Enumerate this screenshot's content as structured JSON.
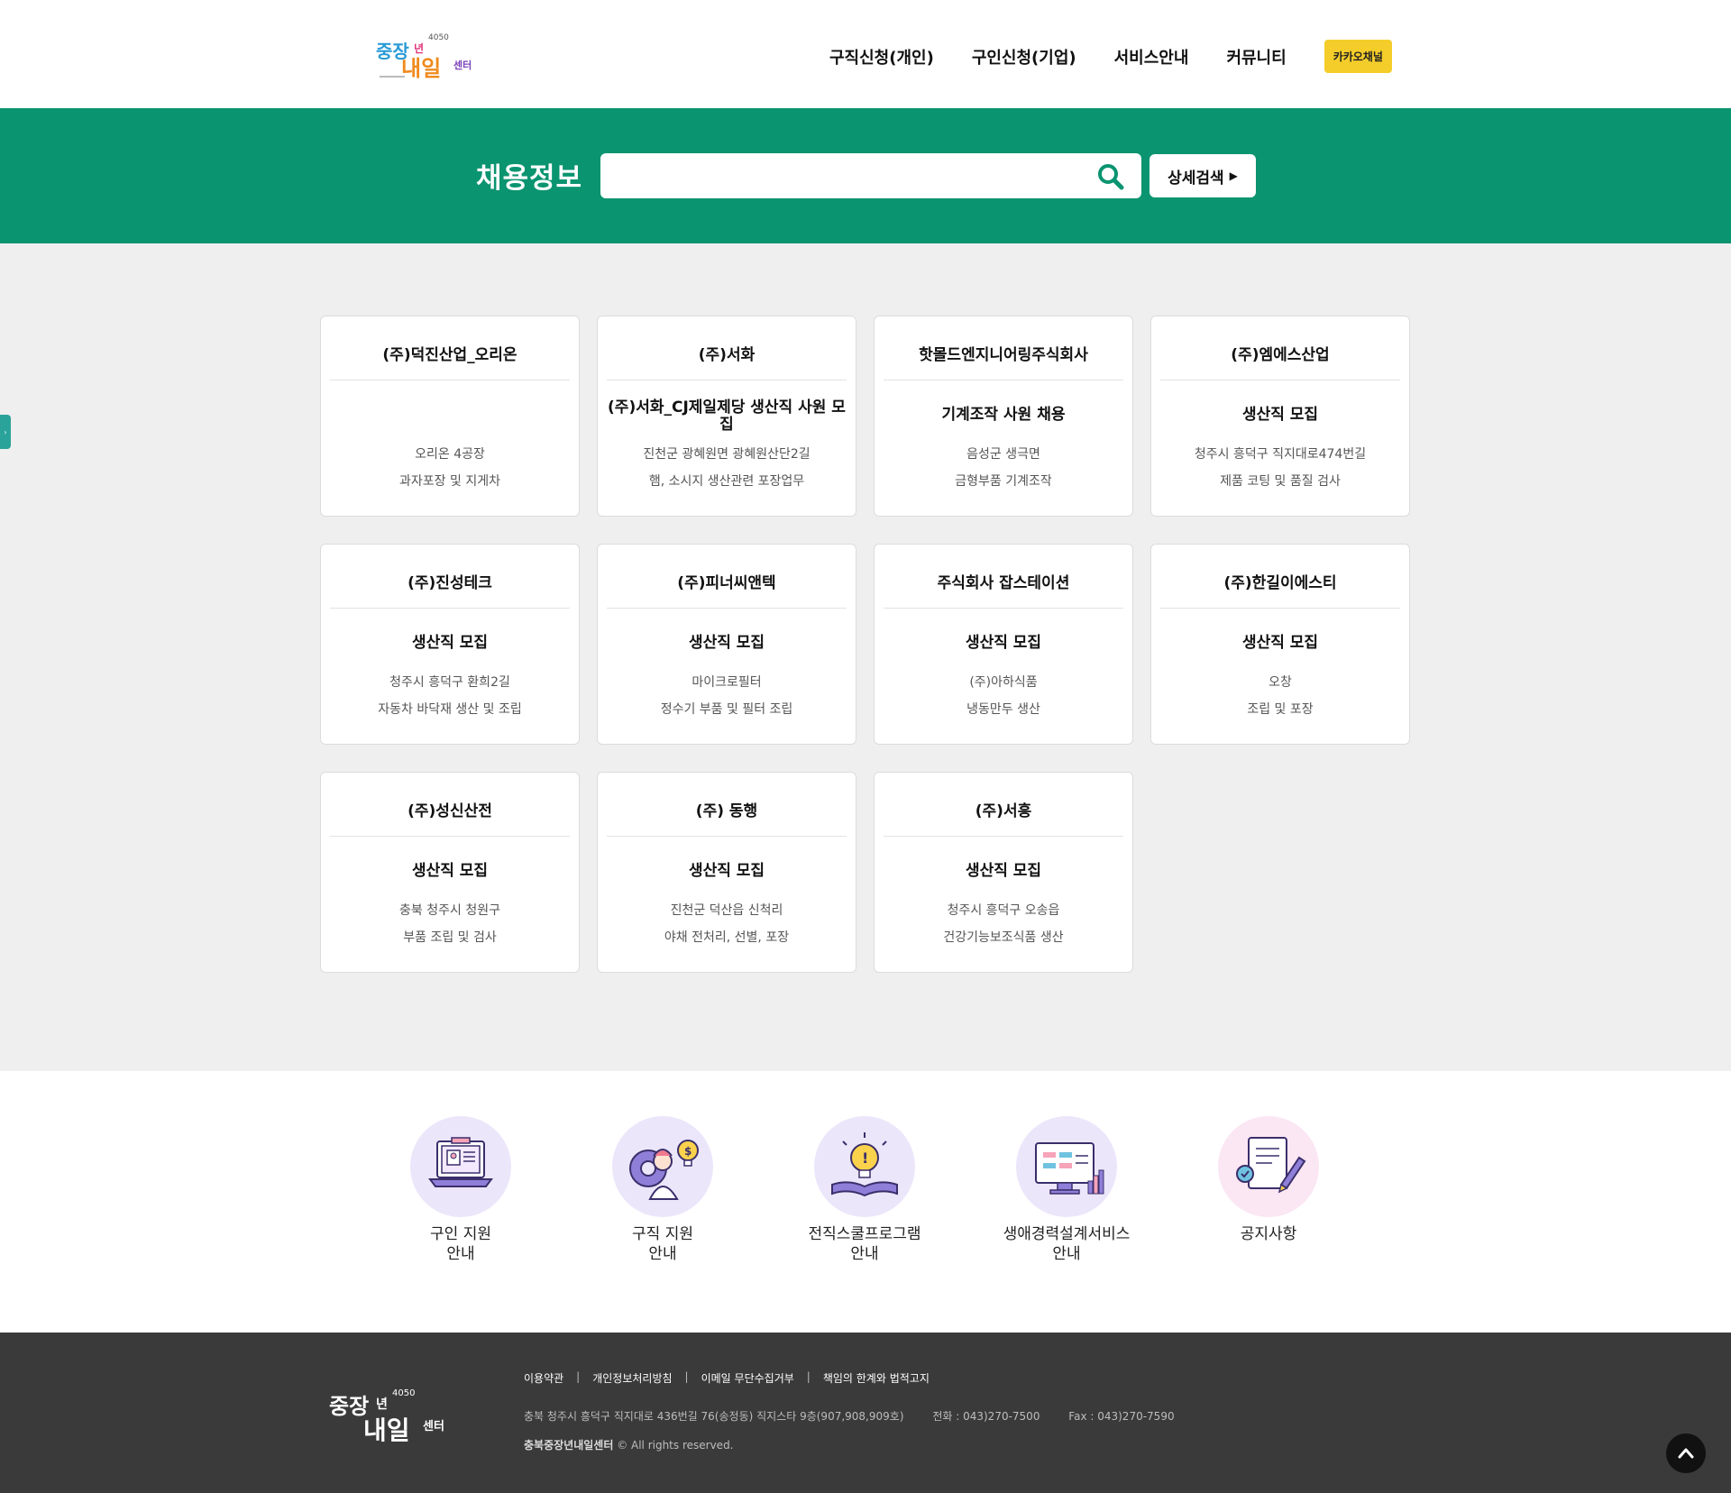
{
  "header": {
    "logo_text": "중장년 내일센터",
    "nav": [
      "구직신청(개인)",
      "구인신청(기업)",
      "서비스안내",
      "커뮤니티"
    ],
    "kakao_label": "카카오채널"
  },
  "search": {
    "title": "채용정보",
    "placeholder": "",
    "value": "",
    "detail_label": "상세검색"
  },
  "jobs": [
    {
      "company": "(주)덕진산업_오리온",
      "title": "",
      "line1": "오리온 4공장",
      "line2": "과자포장 및 지게차"
    },
    {
      "company": "(주)서화",
      "title": "(주)서화_CJ제일제당 생산직 사원 모집",
      "line1": "진천군 광혜원면 광혜원산단2길",
      "line2": "햄, 소시지 생산관련 포장업무"
    },
    {
      "company": "핫몰드엔지니어링주식회사",
      "title": "기계조작 사원 채용",
      "line1": "음성군 생극면",
      "line2": "금형부품 기계조작"
    },
    {
      "company": "(주)엠에스산업",
      "title": "생산직 모집",
      "line1": "청주시 흥덕구 직지대로474번길",
      "line2": "제품 코팅 및 품질 검사"
    },
    {
      "company": "(주)진성테크",
      "title": "생산직 모집",
      "line1": "청주시 흥덕구 환희2길",
      "line2": "자동차 바닥재 생산 및 조립"
    },
    {
      "company": "(주)피너씨앤텍",
      "title": "생산직 모집",
      "line1": "마이크로필터",
      "line2": "정수기 부품 및 필터 조립"
    },
    {
      "company": "주식회사 잡스테이션",
      "title": "생산직 모집",
      "line1": "(주)아하식품",
      "line2": "냉동만두 생산"
    },
    {
      "company": "(주)한길이에스티",
      "title": "생산직 모집",
      "line1": "오창",
      "line2": "조립 및 포장"
    },
    {
      "company": "(주)성신산전",
      "title": "생산직 모집",
      "line1": "충북 청주시 청원구",
      "line2": "부품 조립 및 검사"
    },
    {
      "company": "(주) 동행",
      "title": "생산직 모집",
      "line1": "진천군 덕산읍 신척리",
      "line2": "야채 전처리, 선별, 포장"
    },
    {
      "company": "(주)서흥",
      "title": "생산직 모집",
      "line1": "청주시 흥덕구 오송읍",
      "line2": "건강기능보조식품 생산"
    }
  ],
  "services": [
    {
      "label1": "구인 지원",
      "label2": "안내",
      "icon": "job-posting-laptop-icon",
      "bg": "#ece6fb"
    },
    {
      "label1": "구직 지원",
      "label2": "안내",
      "icon": "job-seeker-idea-icon",
      "bg": "#ece6fb"
    },
    {
      "label1": "전직스쿨프로그램",
      "label2": "안내",
      "icon": "lightbulb-book-icon",
      "bg": "#ece6fb"
    },
    {
      "label1": "생애경력설계서비스",
      "label2": "안내",
      "icon": "career-monitor-chart-icon",
      "bg": "#ece6fb"
    },
    {
      "label1": "공지사항",
      "label2": "",
      "icon": "notice-document-pen-icon",
      "bg": "#fbe6f3"
    }
  ],
  "footer": {
    "logo_text": "중장년 내일센터",
    "links": [
      "이용약관",
      "개인정보처리방침",
      "이메일 무단수집거부",
      "책임의 한계와 법적고지"
    ],
    "address": "충북 청주시 흥덕구 직지대로 436번길 76(송정동) 직지스타 9층(907,908,909호)",
    "phone": "전화 : 043)270-7500",
    "fax": "Fax : 043)270-7590",
    "copyright_name": "충북중장년내일센터",
    "copyright_rest": " © All rights reserved."
  },
  "colors": {
    "brand_green": "#0a9470",
    "kakao_yellow": "#f5cd2a",
    "footer_bg": "#3a3a3a",
    "main_bg": "#efefef"
  }
}
